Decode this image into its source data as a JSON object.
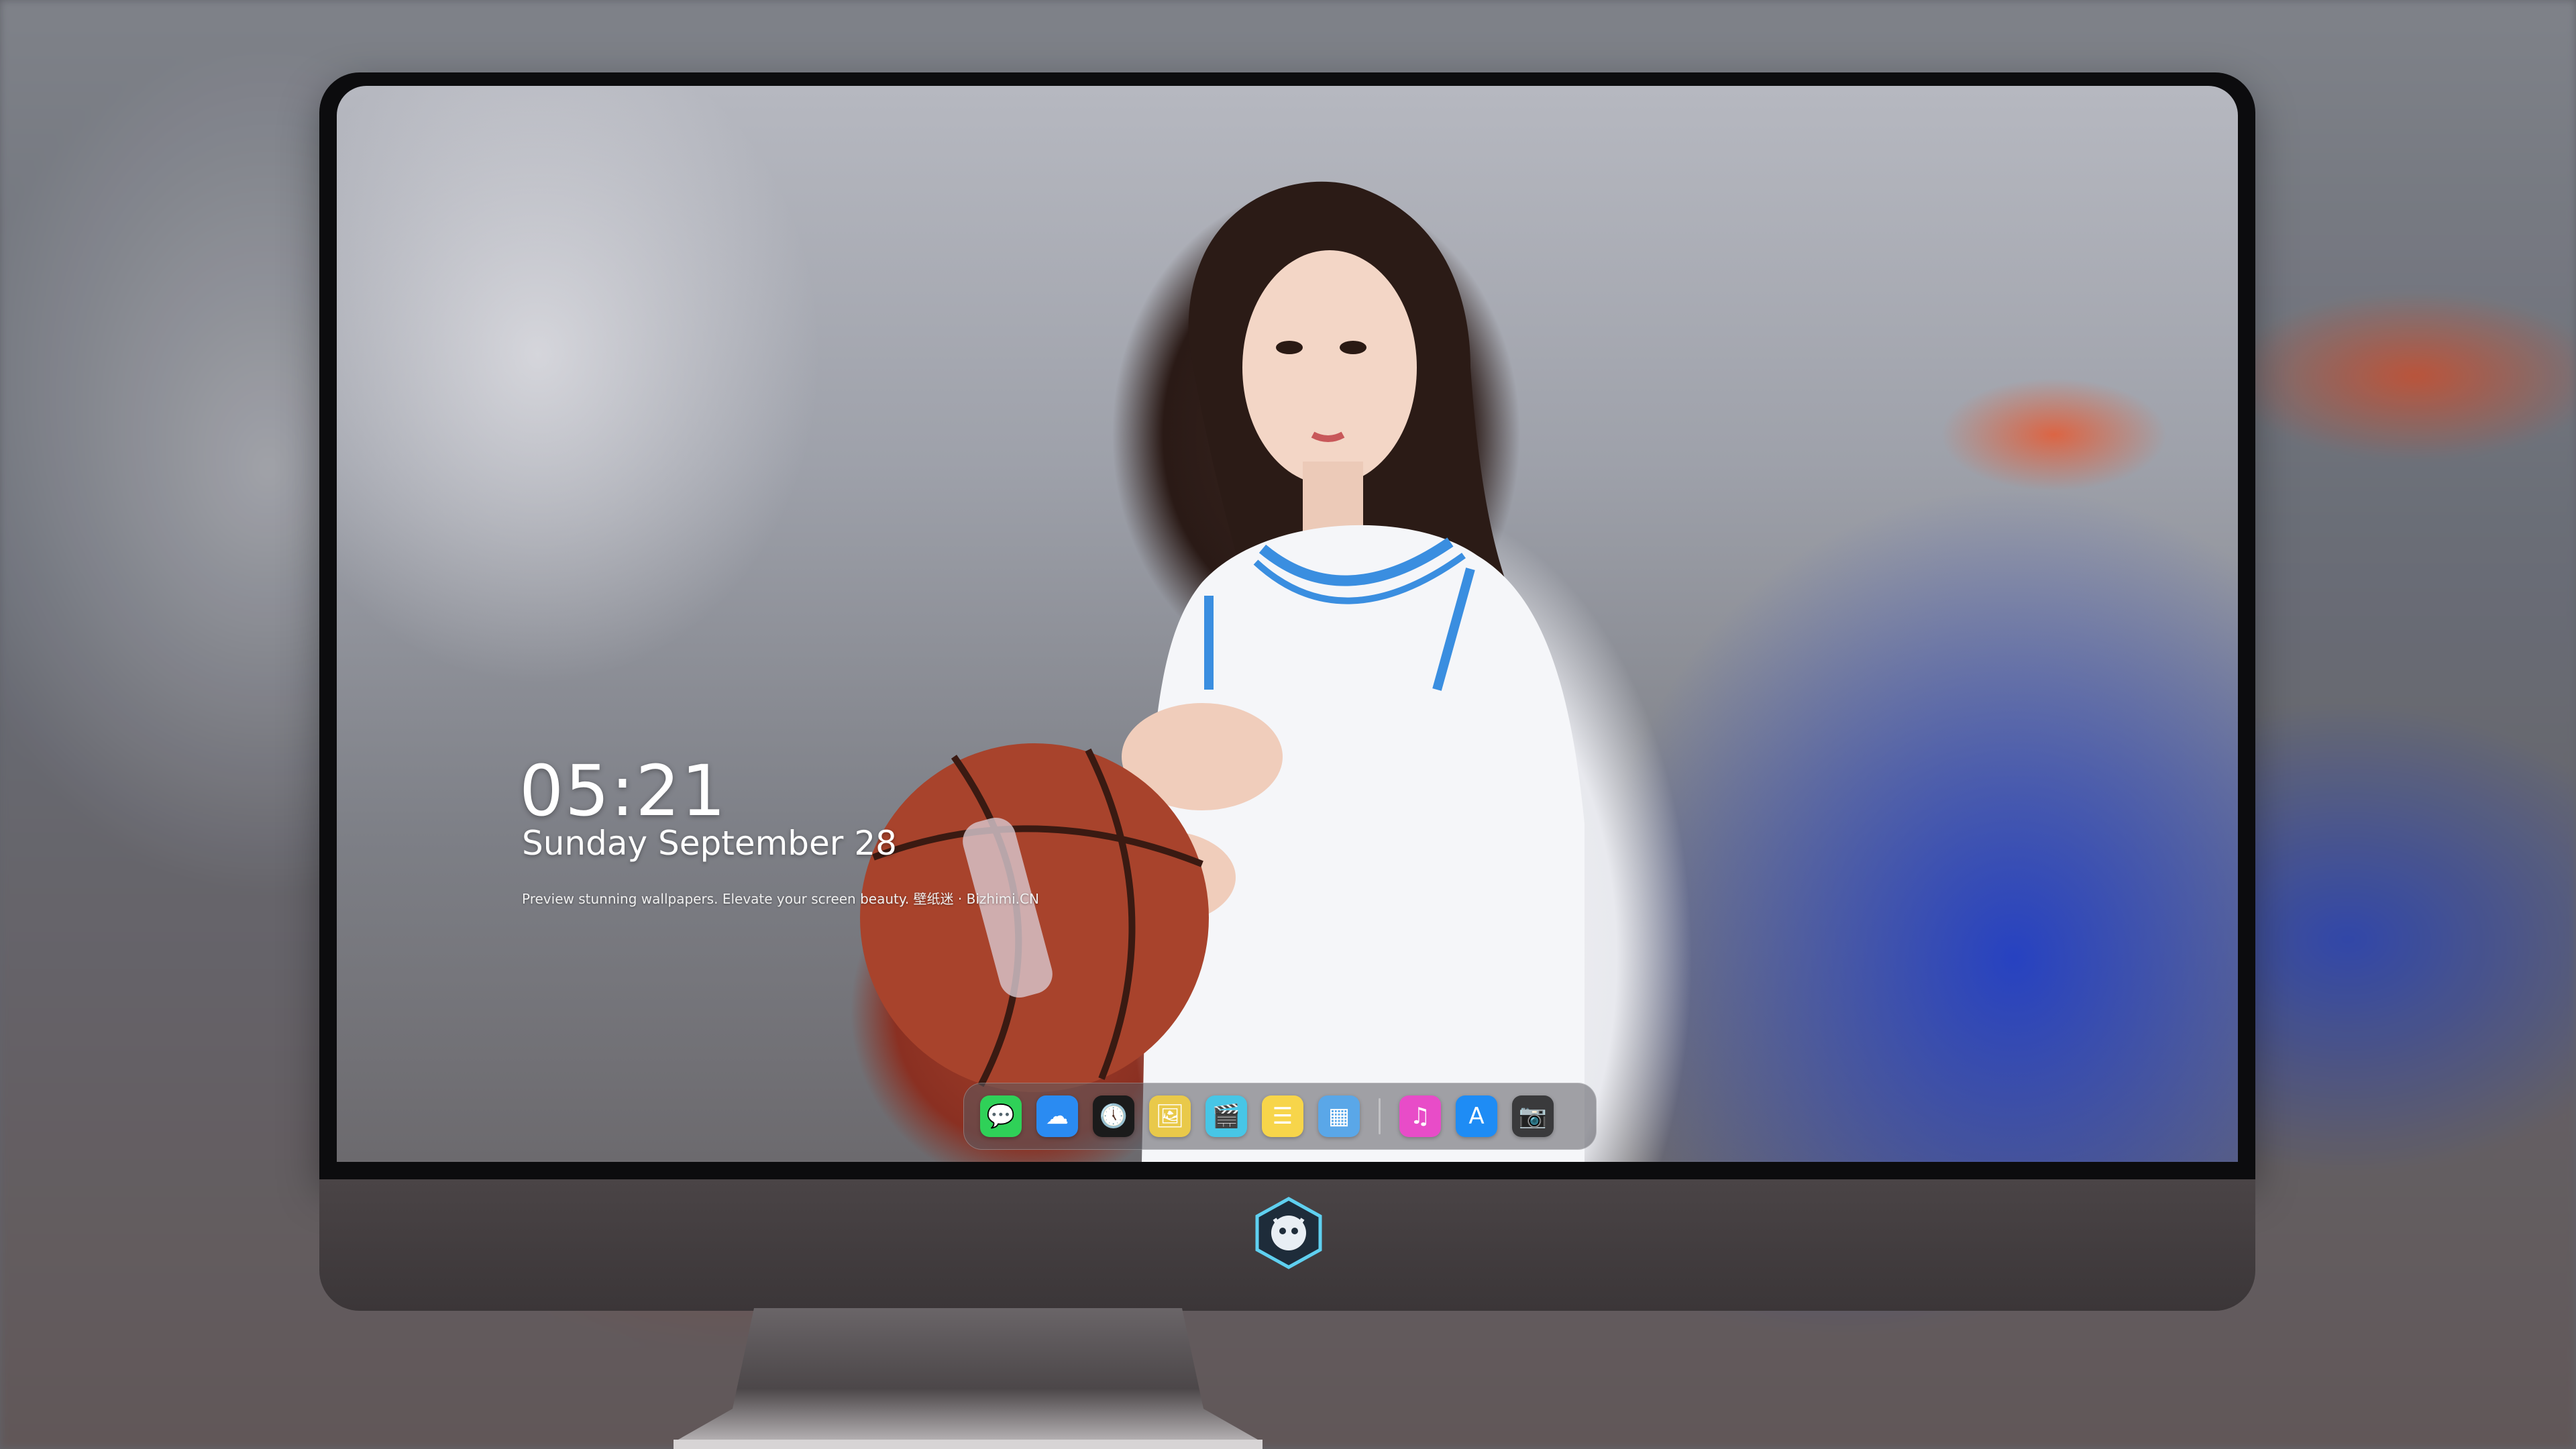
{
  "lockscreen": {
    "time": "05:21",
    "day": "Sunday September",
    "date_number": "28",
    "tagline": "Preview stunning wallpapers. Elevate your screen beauty. 壁纸迷 · Bizhimi.CN"
  },
  "dock": {
    "apps": [
      {
        "name": "messages-icon",
        "glyph": "💬",
        "color": "#2fd158"
      },
      {
        "name": "weather-icon",
        "glyph": "☁",
        "color": "#2a8bf2"
      },
      {
        "name": "clock-icon",
        "glyph": "🕔",
        "color": "#1b1b1b"
      },
      {
        "name": "preview-icon",
        "glyph": "🖼",
        "color": "#e9c94a"
      },
      {
        "name": "clips-icon",
        "glyph": "🎬",
        "color": "#47c6e6"
      },
      {
        "name": "notes-icon",
        "glyph": "☰",
        "color": "#f7d54a"
      },
      {
        "name": "photo-booth-icon",
        "glyph": "▦",
        "color": "#5aa7e8"
      },
      {
        "name": "music-icon",
        "glyph": "♫",
        "color": "#e84cc8"
      },
      {
        "name": "app-store-icon",
        "glyph": "A",
        "color": "#1e8cf5"
      },
      {
        "name": "camera-icon",
        "glyph": "📷",
        "color": "#3a3a3c"
      }
    ]
  },
  "colors": {
    "bezel": "#0c0c0e",
    "chin": "#3b3638",
    "accent_blue": "#1e3cc8"
  }
}
